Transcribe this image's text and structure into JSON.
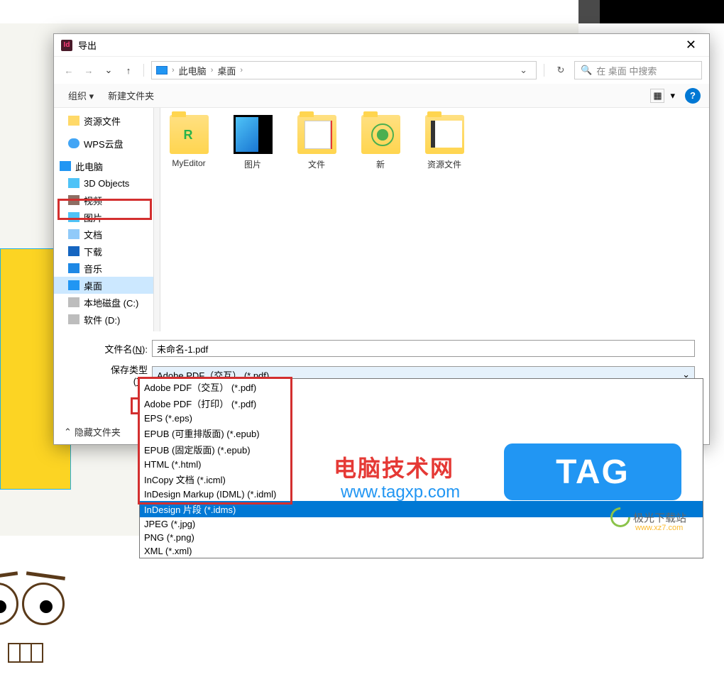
{
  "dialog": {
    "title": "导出",
    "close": "✕"
  },
  "nav": {
    "back": "←",
    "forward": "→",
    "up": "↑",
    "breadcrumbs": [
      "此电脑",
      "桌面"
    ],
    "dropdown": "⌄",
    "refresh": "↻",
    "search_placeholder": "在 桌面 中搜索"
  },
  "toolbar": {
    "organize": "组织",
    "newfolder": "新建文件夹",
    "help": "?"
  },
  "sidebar": {
    "items": [
      {
        "icon": "folder",
        "label": "资源文件"
      },
      {
        "icon": "cloud",
        "label": "WPS云盘"
      },
      {
        "icon": "pc",
        "label": "此电脑",
        "root": true
      },
      {
        "icon": "cube",
        "label": "3D Objects"
      },
      {
        "icon": "vid",
        "label": "视频"
      },
      {
        "icon": "pic",
        "label": "图片"
      },
      {
        "icon": "doc",
        "label": "文档"
      },
      {
        "icon": "dl",
        "label": "下载"
      },
      {
        "icon": "music",
        "label": "音乐"
      },
      {
        "icon": "desk",
        "label": "桌面",
        "selected": true
      },
      {
        "icon": "disk",
        "label": "本地磁盘 (C:)"
      },
      {
        "icon": "disk",
        "label": "软件 (D:)"
      }
    ]
  },
  "folders": [
    {
      "type": "me",
      "label": "MyEditor"
    },
    {
      "type": "pic",
      "label": "图片"
    },
    {
      "type": "doc",
      "label": "文件"
    },
    {
      "type": "new",
      "label": "新"
    },
    {
      "type": "res",
      "label": "资源文件"
    }
  ],
  "fields": {
    "filename_label": "文件名(N):",
    "filename_value": "未命名-1.pdf",
    "savetype_label": "保存类型(T):",
    "savetype_value": "Adobe PDF（交互）  (*.pdf)"
  },
  "dropdown_options": [
    {
      "label": "Adobe PDF（交互）  (*.pdf)"
    },
    {
      "label": "Adobe PDF（打印）  (*.pdf)"
    },
    {
      "label": "EPS (*.eps)"
    },
    {
      "label": "EPUB (可重排版面)   (*.epub)"
    },
    {
      "label": "EPUB (固定版面)   (*.epub)"
    },
    {
      "label": "HTML (*.html)"
    },
    {
      "label": "InCopy 文档 (*.icml)"
    },
    {
      "label": "InDesign Markup (IDML) (*.idml)"
    },
    {
      "label": "InDesign 片段 (*.idms)",
      "selected": true
    },
    {
      "label": "JPEG (*.jpg)"
    },
    {
      "label": "PNG (*.png)"
    },
    {
      "label": "XML (*.xml)"
    }
  ],
  "footer": {
    "hide": "隐藏文件夹"
  },
  "watermarks": {
    "w1": "电脑技术网",
    "w1b": "www.tagxp.com",
    "tag": "TAG",
    "jg": "极光下载站",
    "jgurl": "www.xz7.com"
  }
}
